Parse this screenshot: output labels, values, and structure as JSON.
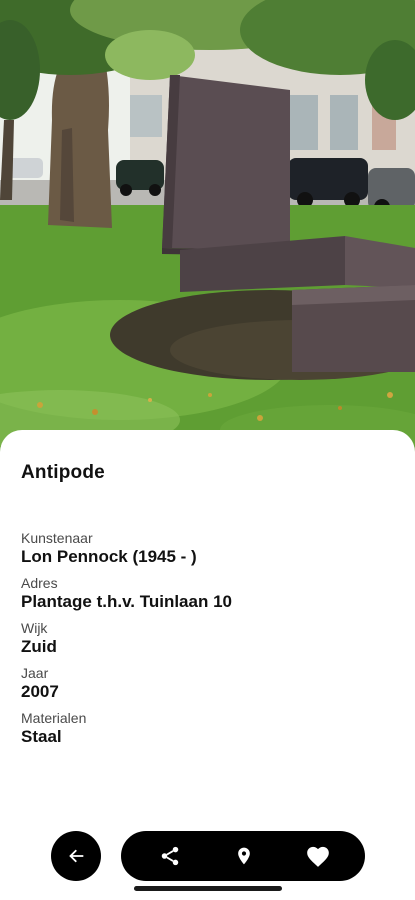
{
  "artwork": {
    "title": "Antipode"
  },
  "details": [
    {
      "label": "Kunstenaar",
      "value": "Lon Pennock (1945 - )"
    },
    {
      "label": "Adres",
      "value": "Plantage t.h.v. Tuinlaan 10"
    },
    {
      "label": "Wijk",
      "value": "Zuid"
    },
    {
      "label": "Jaar",
      "value": "2007"
    },
    {
      "label": "Materialen",
      "value": "Staal"
    }
  ],
  "actions": {
    "back_icon": "arrow-left-icon",
    "share_icon": "share-icon",
    "location_icon": "map-pin-icon",
    "favorite_icon": "heart-icon"
  },
  "colors": {
    "sheet_background": "#ffffff",
    "button_background": "#000000",
    "icon_color": "#ffffff",
    "text_primary": "#111111",
    "text_secondary": "#4a4a4a"
  }
}
